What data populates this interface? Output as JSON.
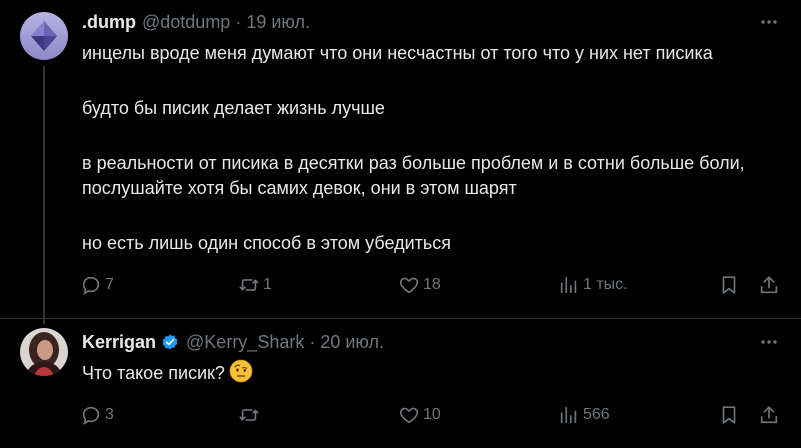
{
  "tweets": [
    {
      "author_name": ".dump",
      "handle": "@dotdump",
      "separator": "·",
      "date": "19 июл.",
      "paragraphs": [
        "инцелы вроде меня думают что они несчастны от того что у них нет писика",
        "будто бы писик делает жизнь лучше",
        "в реальности от писика в десятки раз больше проблем и в сотни больше боли, послушайте хотя бы самих девок, они в этом шарят",
        "но есть лишь один способ в этом убедиться"
      ],
      "stats": {
        "replies": "7",
        "retweets": "1",
        "likes": "18",
        "views": "1 тыс."
      }
    },
    {
      "author_name": "Kerrigan",
      "verified": true,
      "handle": "@Kerry_Shark",
      "separator": "·",
      "date": "20 июл.",
      "text": "Что такое писик?",
      "emoji": "face-with-raised-eyebrow",
      "stats": {
        "replies": "3",
        "retweets": "",
        "likes": "10",
        "views": "566"
      }
    }
  ],
  "colors": {
    "background": "#000000",
    "text_primary": "#e7e9ea",
    "text_secondary": "#71767b",
    "verified_blue": "#1d9bf0",
    "divider": "#2f3336"
  },
  "icons": [
    "more-icon",
    "reply-icon",
    "retweet-icon",
    "like-icon",
    "views-icon",
    "bookmark-icon",
    "share-icon",
    "verified-badge-icon"
  ]
}
